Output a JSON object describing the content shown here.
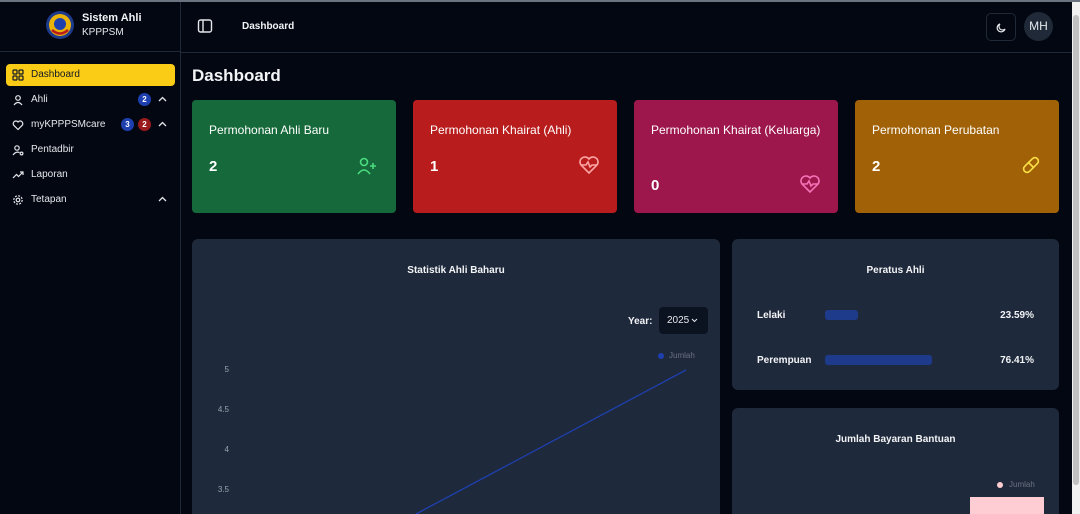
{
  "brand": {
    "title": "Sistem Ahli",
    "subtitle": "KPPPSM"
  },
  "sidebar": {
    "items": [
      {
        "label": "Dashboard",
        "icon": "grid-icon",
        "active": true
      },
      {
        "label": "Ahli",
        "icon": "user-icon",
        "badges": [
          "2"
        ]
      },
      {
        "label": "myKPPPSMcare",
        "icon": "heart-icon",
        "badges": [
          "3",
          "2"
        ]
      },
      {
        "label": "Pentadbir",
        "icon": "user-cog-icon"
      },
      {
        "label": "Laporan",
        "icon": "trending-up-icon"
      },
      {
        "label": "Tetapan",
        "icon": "settings-icon"
      }
    ]
  },
  "topbar": {
    "breadcrumb": "Dashboard",
    "avatar": "MH"
  },
  "page": {
    "title": "Dashboard"
  },
  "cards": [
    {
      "title": "Permohonan Ahli Baru",
      "value": "2",
      "color": "#16693a",
      "icon": "user-plus-icon",
      "icon_color": "#4ade80"
    },
    {
      "title": "Permohonan Khairat (Ahli)",
      "value": "1",
      "color": "#b91c1c",
      "icon": "heart-pulse-icon",
      "icon_color": "#fca5a5"
    },
    {
      "title": "Permohonan Khairat (Keluarga)",
      "value": "0",
      "color": "#9d174d",
      "icon": "heart-pulse-icon",
      "icon_color": "#f472b6"
    },
    {
      "title": "Permohonan Perubatan",
      "value": "2",
      "color": "#a16207",
      "icon": "pill-icon",
      "icon_color": "#fde047"
    }
  ],
  "statistik": {
    "title": "Statistik Ahli Baharu",
    "year_label": "Year:",
    "year_value": "2025",
    "legend": "Jumlah",
    "line_color": "#1e40af"
  },
  "chart_data": {
    "type": "line",
    "title": "Statistik Ahli Baharu",
    "y_ticks": [
      "5",
      "4.5",
      "4",
      "3.5"
    ],
    "ylim": [
      3.5,
      5
    ],
    "series": [
      {
        "name": "Jumlah",
        "points": [
          [
            0,
            3.2
          ],
          [
            1,
            5
          ]
        ]
      }
    ],
    "legend": "top-right"
  },
  "peratus": {
    "title": "Peratus Ahli",
    "rows": [
      {
        "label": "Lelaki",
        "value": 23.59,
        "pct": "23.59%"
      },
      {
        "label": "Perempuan",
        "value": 76.41,
        "pct": "76.41%"
      }
    ]
  },
  "bayaran": {
    "title": "Jumlah Bayaran Bantuan",
    "legend": "Jumlah",
    "bar_color": "#fecdd3"
  },
  "colors": {
    "accent": "#facc15",
    "badge_blue": "#1e40af",
    "badge_red": "#991b1b"
  }
}
